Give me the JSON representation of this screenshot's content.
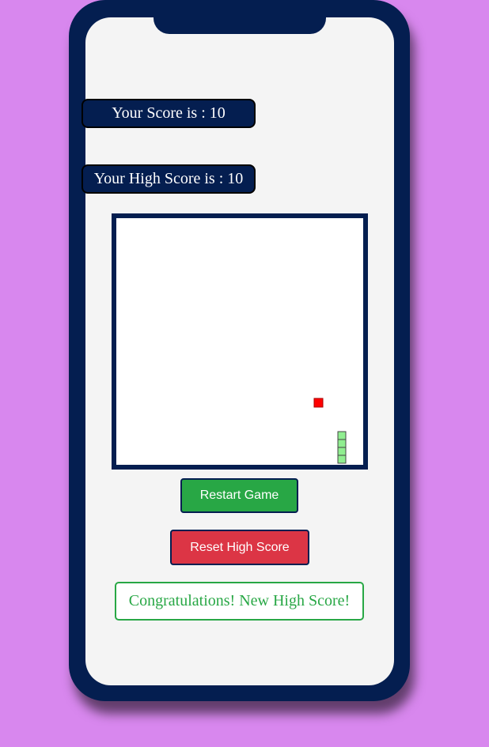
{
  "scoreboard": {
    "score_label": "Your Score is : 10",
    "high_score_label": "Your High Score is : 10"
  },
  "buttons": {
    "restart_label": "Restart Game",
    "reset_label": "Reset High Score"
  },
  "message": "Congratulations! New High Score!",
  "colors": {
    "background": "#d887ee",
    "phone_frame": "#041e50",
    "screen": "#f4f4f4",
    "food": "#ff0000",
    "snake": "#90ee90",
    "restart_button": "#28a745",
    "reset_button": "#dc3545"
  }
}
